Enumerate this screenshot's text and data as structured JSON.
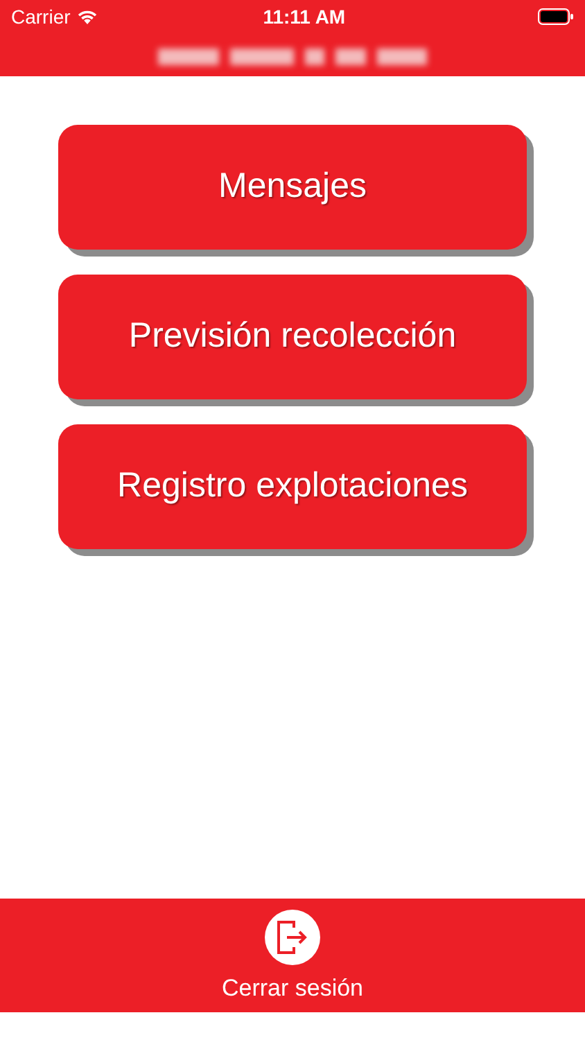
{
  "status_bar": {
    "carrier": "Carrier",
    "time": "11:11 AM"
  },
  "header": {
    "kind": "blurred"
  },
  "menu_buttons": [
    {
      "label": "Mensajes"
    },
    {
      "label": "Previsión recolección"
    },
    {
      "label": "Registro explotaciones"
    }
  ],
  "footer": {
    "label": "Cerrar sesión"
  }
}
